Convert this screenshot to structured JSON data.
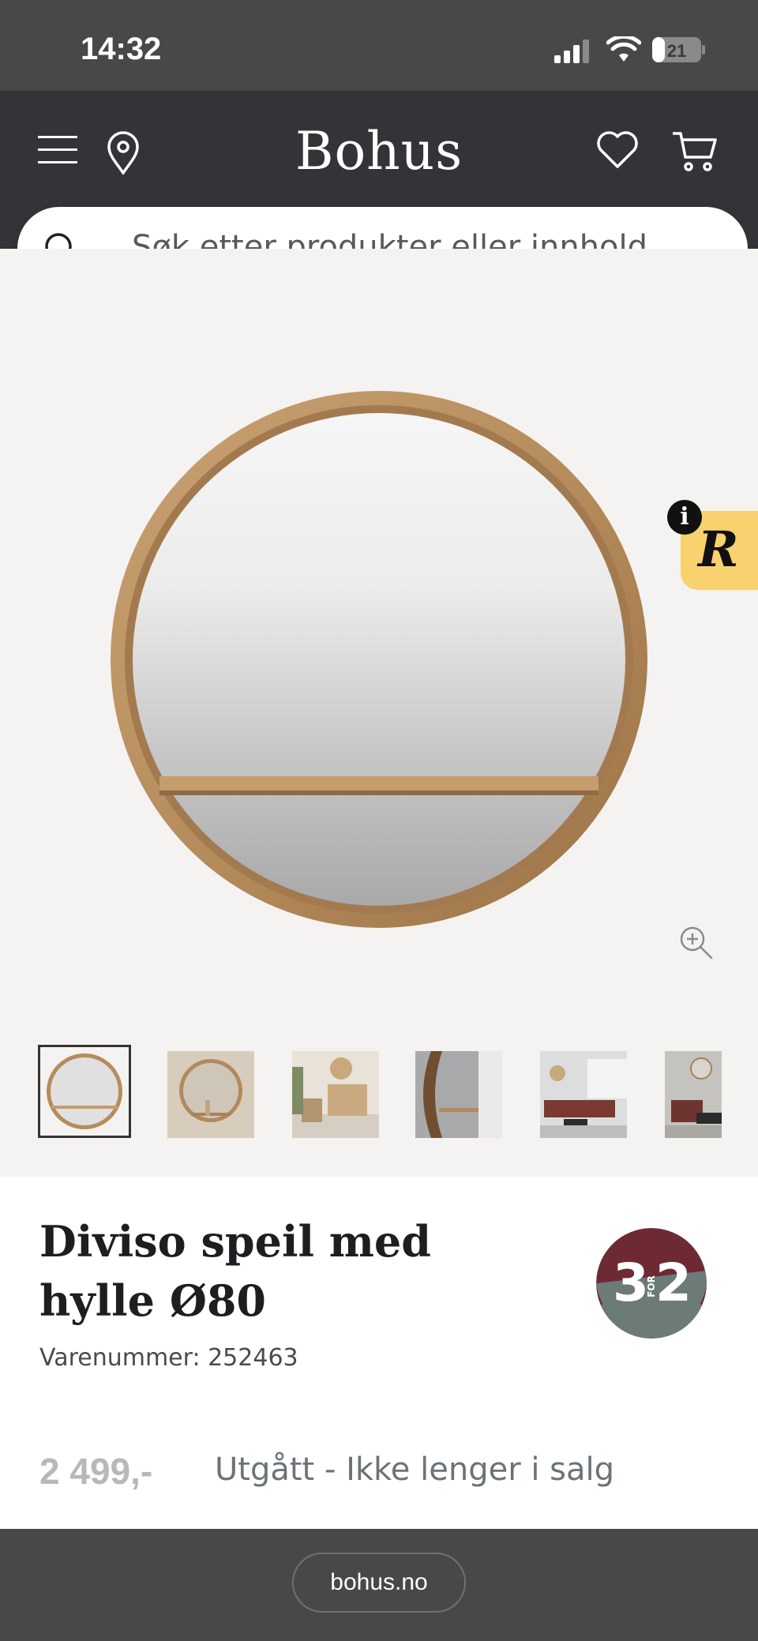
{
  "status_bar": {
    "time": "14:32",
    "battery": "21"
  },
  "header": {
    "logo": "Bohus",
    "icons": [
      "menu-icon",
      "location-pin-icon",
      "heart-icon",
      "cart-icon"
    ]
  },
  "search": {
    "placeholder": "Søk etter produkter eller innhold..."
  },
  "gallery": {
    "badge_letter": "R",
    "badge_info": "i",
    "thumbnails": [
      "thumb-1",
      "thumb-2",
      "thumb-3",
      "thumb-4",
      "thumb-5",
      "thumb-6"
    ],
    "active_thumbnail": 1
  },
  "product": {
    "title": "Diviso speil med hylle Ø80",
    "sku": "Varenummer: 252463",
    "price": "2 499,-",
    "status": "Utgått - Ikke lenger i salg",
    "promo_badge": {
      "big": "3",
      "small": "FOR",
      "big2": "2"
    }
  },
  "bottom_bar": {
    "url": "bohus.no"
  },
  "colors": {
    "header_bg": "#343337",
    "statusbar_bg": "#484849",
    "gallery_bg": "#f5f3f1",
    "promo_top": "#6e2a32",
    "promo_bottom": "#6c7a78",
    "r_badge": "#f7d26f"
  }
}
